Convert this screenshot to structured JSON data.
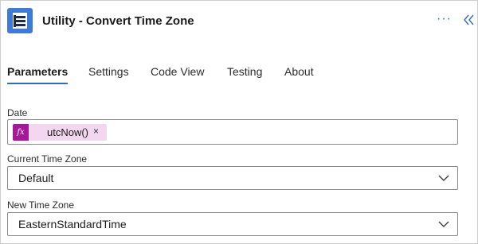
{
  "header": {
    "title": "Utility - Convert Time Zone",
    "app_icon": "utility-app-icon",
    "more_label": "···",
    "collapse_icon": "double-chevron-left-icon"
  },
  "tabs": [
    {
      "label": "Parameters",
      "active": true
    },
    {
      "label": "Settings",
      "active": false
    },
    {
      "label": "Code View",
      "active": false
    },
    {
      "label": "Testing",
      "active": false
    },
    {
      "label": "About",
      "active": false
    }
  ],
  "fields": {
    "date": {
      "label": "Date",
      "token_icon": "fx",
      "token_value": "utcNow()",
      "token_remove": "×"
    },
    "current_time_zone": {
      "label": "Current Time Zone",
      "value": "Default"
    },
    "new_time_zone": {
      "label": "New Time Zone",
      "value": "EasternStandardTime"
    }
  },
  "colors": {
    "accent": "#2f6bc4",
    "token_bg": "#f3d6ef",
    "token_icon_bg": "#a3199a"
  }
}
